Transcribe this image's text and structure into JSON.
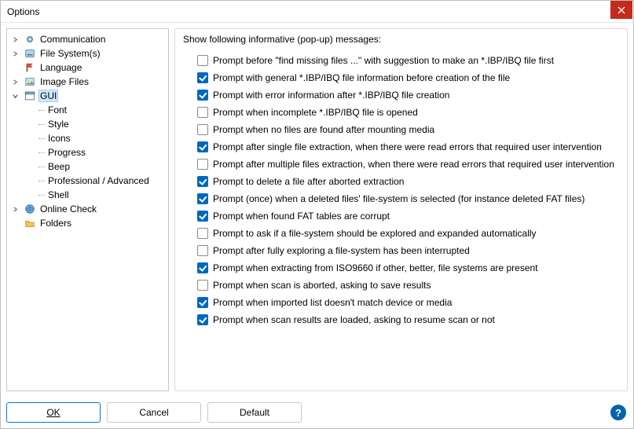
{
  "window": {
    "title": "Options"
  },
  "tree": {
    "items": [
      {
        "id": "communication",
        "label": "Communication",
        "expandable": true,
        "expanded": false,
        "icon": "gear"
      },
      {
        "id": "filesystems",
        "label": "File System(s)",
        "expandable": true,
        "expanded": false,
        "icon": "disk"
      },
      {
        "id": "language",
        "label": "Language",
        "expandable": false,
        "icon": "flag"
      },
      {
        "id": "imagefiles",
        "label": "Image Files",
        "expandable": true,
        "expanded": false,
        "icon": "image"
      },
      {
        "id": "gui",
        "label": "GUI",
        "expandable": true,
        "expanded": true,
        "icon": "window",
        "selected": true
      },
      {
        "id": "font",
        "label": "Font",
        "child": true
      },
      {
        "id": "style",
        "label": "Style",
        "child": true
      },
      {
        "id": "icons",
        "label": "Icons",
        "child": true
      },
      {
        "id": "progress",
        "label": "Progress",
        "child": true
      },
      {
        "id": "beep",
        "label": "Beep",
        "child": true
      },
      {
        "id": "pro",
        "label": "Professional / Advanced",
        "child": true
      },
      {
        "id": "shell",
        "label": "Shell",
        "child": true
      },
      {
        "id": "online",
        "label": "Online Check",
        "expandable": true,
        "expanded": false,
        "icon": "globe"
      },
      {
        "id": "folders",
        "label": "Folders",
        "expandable": false,
        "icon": "folder"
      }
    ]
  },
  "group": {
    "title": "Show following informative (pop-up) messages:"
  },
  "checks": [
    {
      "checked": false,
      "label": "Prompt before \"find missing files ...\" with suggestion to make an *.IBP/IBQ file first"
    },
    {
      "checked": true,
      "label": "Prompt with general *.IBP/IBQ file information before creation of the file"
    },
    {
      "checked": true,
      "label": "Prompt with error information after *.IBP/IBQ file creation"
    },
    {
      "checked": false,
      "label": "Prompt when incomplete *.IBP/IBQ file is opened"
    },
    {
      "checked": false,
      "label": "Prompt when no files are found after mounting media"
    },
    {
      "checked": true,
      "label": "Prompt after single file extraction, when there were read errors that required user intervention"
    },
    {
      "checked": false,
      "label": "Prompt after multiple files extraction, when there were read errors that required user intervention"
    },
    {
      "checked": true,
      "label": "Prompt to delete a file after aborted extraction"
    },
    {
      "checked": true,
      "label": "Prompt (once) when a deleted files' file-system is selected (for instance deleted FAT files)"
    },
    {
      "checked": true,
      "label": "Prompt when found FAT tables are corrupt"
    },
    {
      "checked": false,
      "label": "Prompt to ask if a file-system should be explored and expanded automatically"
    },
    {
      "checked": false,
      "label": "Prompt after fully exploring a file-system has been interrupted"
    },
    {
      "checked": true,
      "label": "Prompt when extracting from ISO9660 if other, better, file systems are present"
    },
    {
      "checked": false,
      "label": "Prompt when scan is aborted, asking to save results"
    },
    {
      "checked": true,
      "label": "Prompt when imported list doesn't match device or media"
    },
    {
      "checked": true,
      "label": "Prompt when scan results are loaded, asking to resume scan or not"
    }
  ],
  "buttons": {
    "ok": "OK",
    "cancel": "Cancel",
    "default": "Default"
  }
}
